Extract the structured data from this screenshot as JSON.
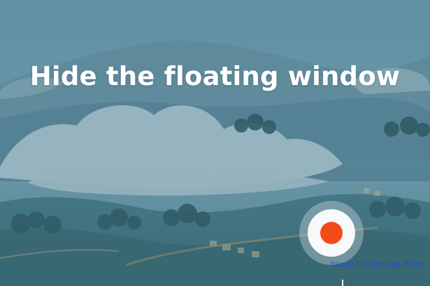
{
  "screen": {
    "title": "Hide the floating window"
  },
  "record_button": {
    "icon": "record-icon",
    "accent": "#f24a18"
  },
  "watermark": {
    "text": "itsmeit | Technology Blogs"
  }
}
